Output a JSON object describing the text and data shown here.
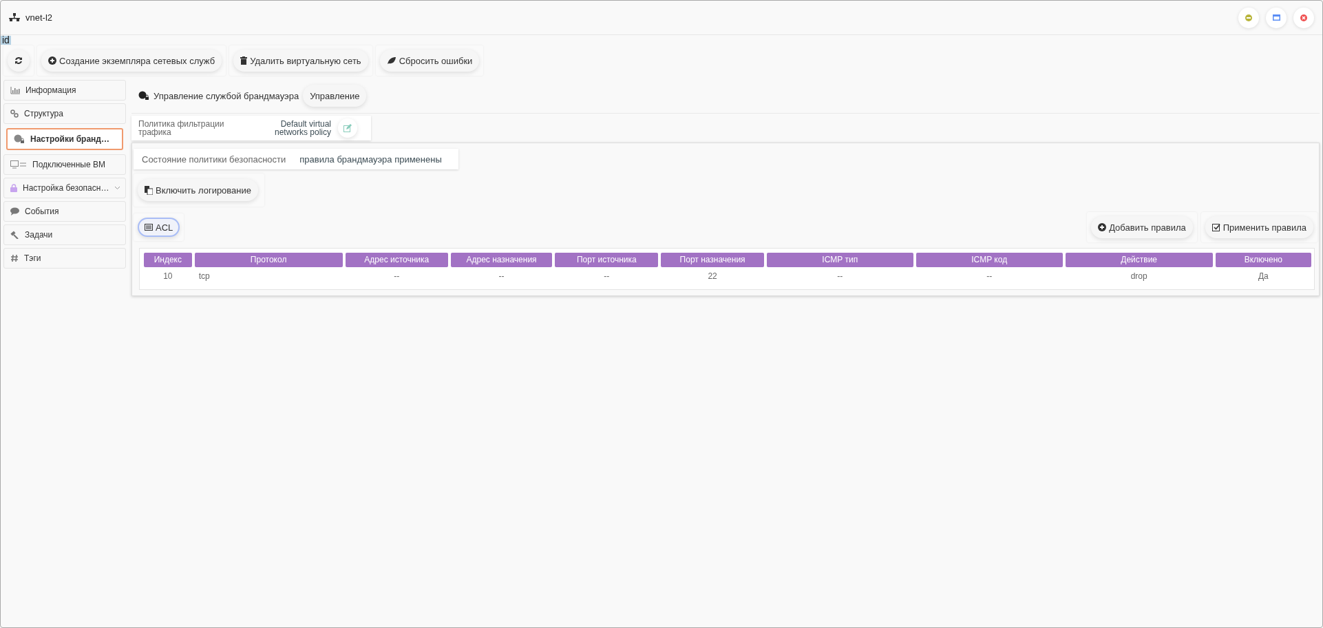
{
  "window": {
    "title": "vnet-l2",
    "badge": "id"
  },
  "toolbar": [
    {
      "kind": "refresh"
    },
    {
      "kind": "create",
      "label": "Создание экземпляра сетевых служб"
    },
    {
      "kind": "delete",
      "label": "Удалить виртуальную сеть"
    },
    {
      "kind": "reset",
      "label": "Сбросить ошибки"
    }
  ],
  "sidebar": {
    "items": [
      {
        "label": "Информация",
        "selected": false
      },
      {
        "label": "Структура",
        "selected": false
      },
      {
        "label": "Настройки бранд…",
        "selected": true
      },
      {
        "label": "Подключенные ВМ",
        "selected": false
      },
      {
        "label": "Настройка безопасн…",
        "selected": false,
        "expanded": false
      },
      {
        "label": "События",
        "selected": false
      },
      {
        "label": "Задачи",
        "selected": false
      },
      {
        "label": "Тэги",
        "selected": false
      }
    ]
  },
  "heading": {
    "title": "Управление службой брандмауэра",
    "button": "Управление"
  },
  "policy": {
    "label": "Политика фильтрации трафика",
    "value": "Default virtual networks policy"
  },
  "status": {
    "label": "Состояние политики безопасности",
    "value": "правила брандмауэра применены"
  },
  "logging_button": "Включить логирование",
  "acl_tab": {
    "label": "ACL",
    "selected": true
  },
  "actions": [
    "Добавить правила",
    "Применить правила"
  ],
  "table": {
    "columns": [
      "Индекс",
      "Протокол",
      "Адрес источника",
      "Адрес назначения",
      "Порт источника",
      "Порт назначения",
      "ICMP тип",
      "ICMP код",
      "Действие",
      "Включено"
    ],
    "rows": [
      [
        "10",
        "tcp",
        "--",
        "--",
        "--",
        "22",
        "--",
        "--",
        "drop",
        "Да"
      ]
    ]
  }
}
